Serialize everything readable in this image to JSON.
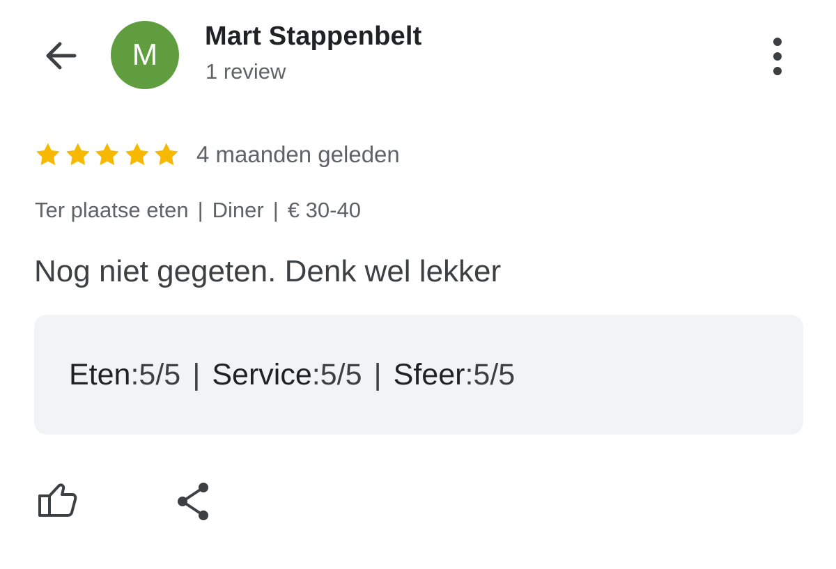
{
  "header": {
    "back_icon": "arrow-back-icon",
    "avatar": {
      "letter": "M",
      "color": "#5f9d3f"
    },
    "author_name": "Mart Stappenbelt",
    "review_count": "1 review",
    "more_icon": "more-vert-icon"
  },
  "review": {
    "star_rating": 5,
    "star_color": "#f6b800",
    "date": "4 maanden geleden",
    "meta": {
      "service_type": "Ter plaatse eten",
      "meal_type": "Diner",
      "price_range": "€ 30-40",
      "separator": "|"
    },
    "text": "Nog niet gegeten. Denk wel lekker"
  },
  "ratings_box": {
    "background": "#f1f3f4",
    "items": [
      {
        "label": "Eten",
        "value": "5/5"
      },
      {
        "label": "Service",
        "value": "5/5"
      },
      {
        "label": "Sfeer",
        "value": "5/5"
      }
    ],
    "separator": "|"
  },
  "actions": {
    "like_icon": "thumbs-up-icon",
    "share_icon": "share-icon"
  },
  "colors": {
    "primary_text": "#202124",
    "secondary_text": "#5f6368",
    "body_text": "#3c4043",
    "icon": "#3c4043"
  }
}
